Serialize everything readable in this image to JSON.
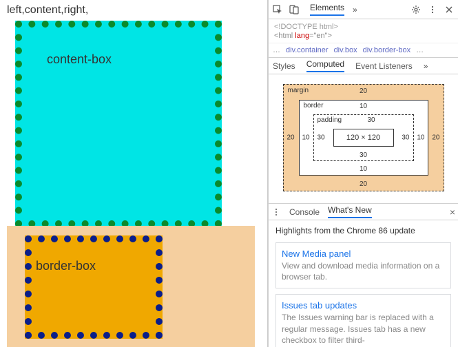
{
  "page": {
    "text_line": "left,content,right,",
    "content_box_label": "content-box",
    "border_box_label": "border-box"
  },
  "devtools": {
    "top_tabs": {
      "elements": "Elements"
    },
    "code_line1": "<!DOCTYPE html>",
    "code_line2_open": "<html ",
    "code_line2_attr": "lang",
    "code_line2_eq": "=\"en\">",
    "breadcrumb": {
      "ellipsis": "…",
      "items": [
        "div.container",
        "div.box",
        "div.border-box"
      ],
      "trail": "…"
    },
    "subtabs": {
      "styles": "Styles",
      "computed": "Computed",
      "listeners": "Event Listeners"
    },
    "boxmodel": {
      "labels": {
        "margin": "margin",
        "border": "border",
        "padding": "padding"
      },
      "margin": {
        "top": "20",
        "right": "20",
        "bottom": "20",
        "left": "20"
      },
      "border": {
        "top": "10",
        "right": "10",
        "bottom": "10",
        "left": "10"
      },
      "padding": {
        "top": "30",
        "right": "30",
        "bottom": "30",
        "left": "30"
      },
      "content": "120 × 120"
    },
    "drawer": {
      "console": "Console",
      "whatsnew": "What's New",
      "close": "×",
      "highlights": "Highlights from the Chrome 86 update",
      "cards": [
        {
          "title": "New Media panel",
          "desc": "View and download media information on a browser tab."
        },
        {
          "title": "Issues tab updates",
          "desc": "The Issues warning bar is replaced with a regular message. Issues tab has a new checkbox to filter third-"
        }
      ]
    }
  }
}
